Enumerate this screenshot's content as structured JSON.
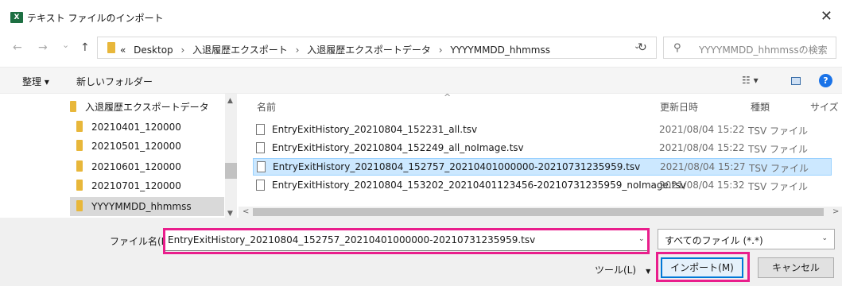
{
  "window": {
    "app_icon": "X",
    "title": "テキスト ファイルのインポート",
    "close": "✕"
  },
  "nav": {
    "back": "←",
    "forward": "→",
    "recent": "⌄",
    "up": "↑",
    "breadcrumbs": [
      "«",
      "Desktop",
      "入退履歴エクスポート",
      "入退履歴エクスポートデータ",
      "YYYYMMDD_hhmmss"
    ],
    "separator": "›",
    "dropdown": "⌄",
    "refresh": "↻",
    "search_placeholder": "YYYYMMDD_hhmmssの検索"
  },
  "toolbar": {
    "organize": "整理 ▾",
    "new_folder": "新しいフォルダー",
    "view": "☷ ▾",
    "help": "?"
  },
  "tree": {
    "items": [
      {
        "label": "入退履歴エクスポートデータ"
      },
      {
        "label": "20210401_120000"
      },
      {
        "label": "20210501_120000"
      },
      {
        "label": "20210601_120000"
      },
      {
        "label": "20210701_120000"
      },
      {
        "label": "YYYYMMDD_hhmmss"
      }
    ]
  },
  "list": {
    "headers": {
      "name": "名前",
      "modified": "更新日時",
      "type": "種類",
      "size": "サイズ"
    },
    "rows": [
      {
        "name": "EntryExitHistory_20210804_152231_all.tsv",
        "modified": "2021/08/04 15:22",
        "type": "TSV ファイル"
      },
      {
        "name": "EntryExitHistory_20210804_152249_all_noImage.tsv",
        "modified": "2021/08/04 15:22",
        "type": "TSV ファイル"
      },
      {
        "name": "EntryExitHistory_20210804_152757_20210401000000-20210731235959.tsv",
        "modified": "2021/08/04 15:27",
        "type": "TSV ファイル"
      },
      {
        "name": "EntryExitHistory_20210804_153202_20210401123456-20210731235959_noImage.tsv",
        "modified": "2021/08/04 15:32",
        "type": "TSV ファイル"
      }
    ],
    "selected_index": 2
  },
  "bottom": {
    "filename_label": "ファイル名(N):",
    "filename_value": "EntryExitHistory_20210804_152757_20210401000000-20210731235959.tsv",
    "filetype_value": "すべてのファイル (*.*)",
    "tools_label": "ツール(L)",
    "import_label": "インポート(M)",
    "cancel_label": "キャンセル"
  },
  "colors": {
    "highlight": "#e91e8c",
    "selection_bg": "#cce8ff",
    "folder": "#e8b73a",
    "accent": "#0078d7"
  }
}
